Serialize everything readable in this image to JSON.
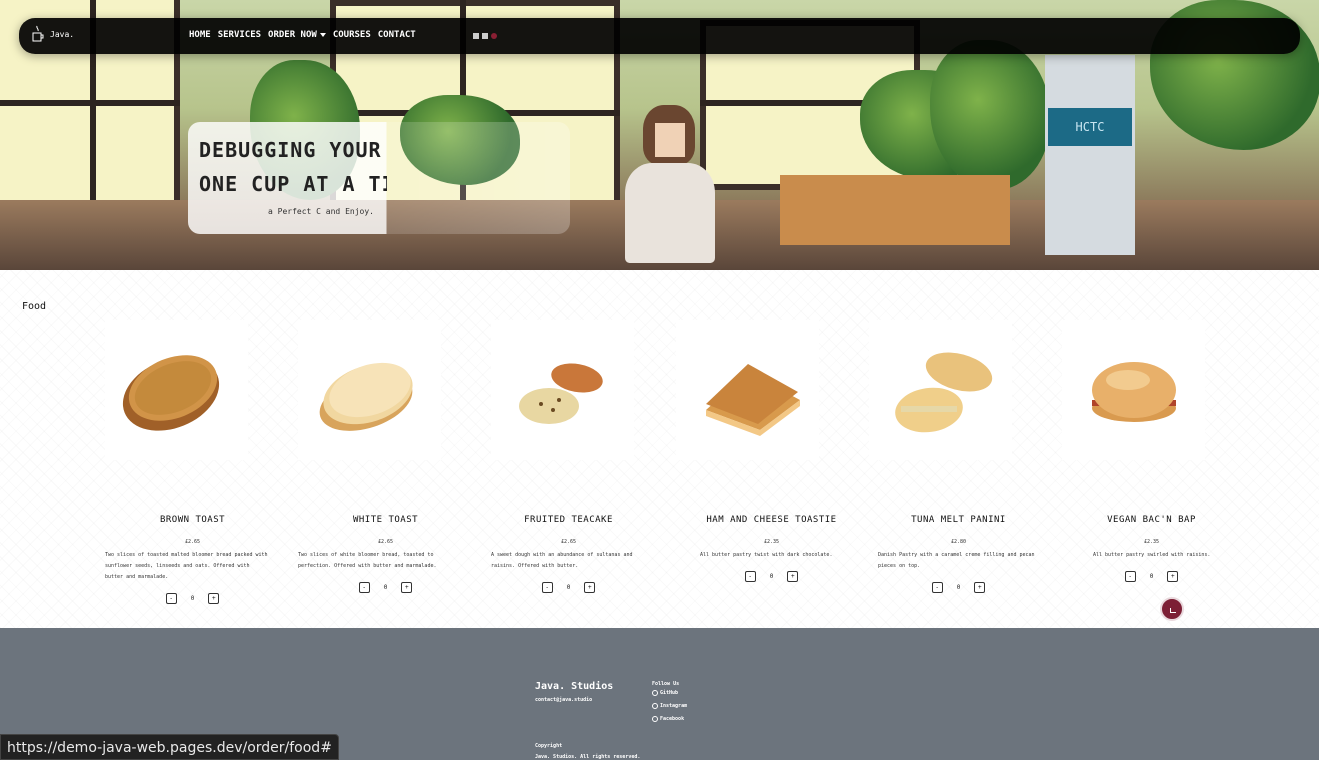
{
  "nav": {
    "logo_text": "Java.",
    "links": [
      "HOME",
      "SERVICES",
      "ORDER NOW",
      "COURSES",
      "CONTACT"
    ]
  },
  "hero": {
    "title_line1": "DEBUGGING YOUR DA",
    "title_line2": "ONE CUP AT A TIMI",
    "subtitle": "a Perfect C  and Enjoy."
  },
  "food": {
    "section_title": "Food",
    "items": [
      {
        "name": "BROWN TOAST",
        "price": "£2.65",
        "desc": "Two slices of toasted malted bloomer bread packed with sunflower seeds, linseeds and oats. Offered with butter and marmalade.",
        "qty": "0"
      },
      {
        "name": "WHITE TOAST",
        "price": "£2.65",
        "desc": "Two slices of white bloomer bread, toasted to perfection. Offered with butter and marmalade.",
        "qty": "0"
      },
      {
        "name": "FRUITED TEACAKE",
        "price": "£2.65",
        "desc": "A sweet dough with an abundance of sultanas and raisins. Offered with butter.",
        "qty": "0"
      },
      {
        "name": "HAM AND CHEESE TOASTIE",
        "price": "£2.35",
        "desc": "All butter pastry twist with dark chocolate.",
        "qty": "0"
      },
      {
        "name": "TUNA MELT PANINI",
        "price": "£2.80",
        "desc": "Danish Pastry with a caramel creme filling and pecan pieces on top.",
        "qty": "0"
      },
      {
        "name": "VEGAN BAC'N BAP",
        "price": "£2.35",
        "desc": "All butter pastry swirled with raisins.",
        "qty": "0"
      }
    ],
    "minus_label": "-",
    "plus_label": "+"
  },
  "footer": {
    "brand": "Java. Studios",
    "email": "contact@java.studio",
    "follow_title": "Follow Us",
    "socials": [
      "GitHub",
      "Instagram",
      "Facebook"
    ],
    "copyright_title": "Copyright",
    "copyright_text": "Java. Studios. All rights reserved."
  },
  "status_url": "https://demo-java-web.pages.dev/order/food#",
  "colors": {
    "accent": "#7c1f35",
    "footer_bg": "#6c747d",
    "navbar_bg": "#000000"
  }
}
